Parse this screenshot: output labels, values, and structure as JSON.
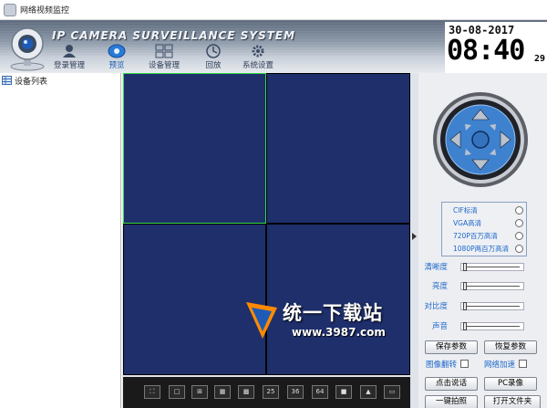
{
  "window": {
    "title": "网络视频监控"
  },
  "header": {
    "brand": "IP CAMERA SURVEILLANCE SYSTEM",
    "nav": [
      {
        "label": "登录管理",
        "icon": "user-login-icon"
      },
      {
        "label": "预览",
        "icon": "preview-eye-icon",
        "active": true
      },
      {
        "label": "设备管理",
        "icon": "device-manage-icon"
      },
      {
        "label": "回放",
        "icon": "playback-icon"
      },
      {
        "label": "系统设置",
        "icon": "gear-icon"
      }
    ],
    "clock": {
      "date": "30-08-2017",
      "time": "08:40",
      "seconds": "29"
    }
  },
  "devices": {
    "title": "设备列表"
  },
  "video": {
    "toolbar": [
      "",
      "",
      "",
      "",
      "",
      "25",
      "36",
      "64",
      "",
      "",
      ""
    ]
  },
  "ptz": {
    "icon": "ptz-direction-pad-icon"
  },
  "resolution": {
    "options": [
      "CIF标清",
      "VGA高清",
      "720P百万高清",
      "1080P两百万高清"
    ]
  },
  "sliders": [
    {
      "label": "清晰度",
      "value": 0
    },
    {
      "label": "亮度",
      "value": 0
    },
    {
      "label": "对比度",
      "value": 0
    },
    {
      "label": "声音",
      "value": 0
    }
  ],
  "buttons": {
    "save": "保存参数",
    "restore": "恢复参数",
    "talk": "点击说话",
    "record": "PC录像",
    "snapshot": "一键拍照",
    "openfolder": "打开文件夹"
  },
  "checks": {
    "flip": "图像翻转",
    "accel": "网络加速"
  },
  "watermark": {
    "title": "统一下载站",
    "url": "www.3987.com"
  },
  "colors": {
    "video_bg": "#1e2f6c",
    "selected_border": "#38d84a",
    "label_blue": "#1c66c8"
  }
}
